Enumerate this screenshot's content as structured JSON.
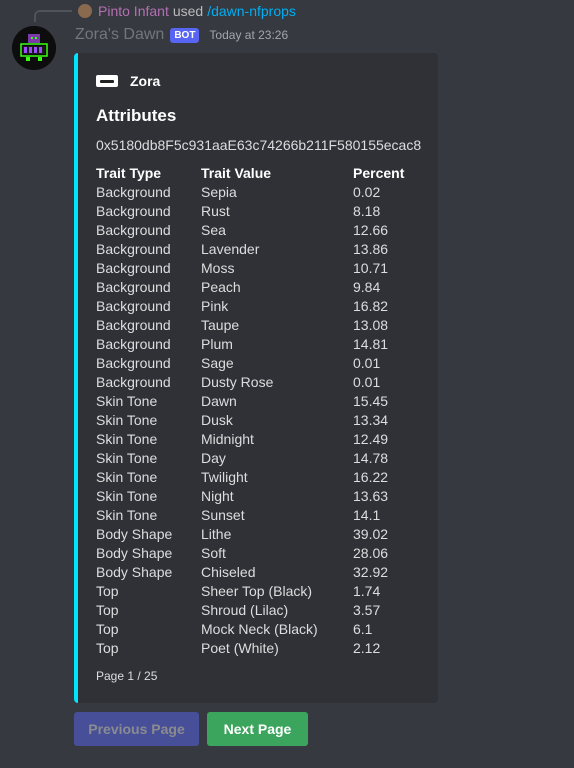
{
  "reply": {
    "user": "Pinto Infant",
    "used": "used",
    "command": "/dawn-nfprops"
  },
  "message": {
    "username": "Zora's Dawn",
    "bot_tag": "BOT",
    "timestamp": "Today at 23:26"
  },
  "embed": {
    "accent_color": "#00e5ff",
    "author": "Zora",
    "title": "Attributes",
    "address": "0x5180db8F5c931aaE63c74266b211F580155ecac8",
    "headers": {
      "type": "Trait Type",
      "value": "Trait Value",
      "percent": "Percent"
    },
    "rows": [
      {
        "type": "Background",
        "value": "Sepia",
        "percent": "0.02"
      },
      {
        "type": "Background",
        "value": "Rust",
        "percent": "8.18"
      },
      {
        "type": "Background",
        "value": "Sea",
        "percent": "12.66"
      },
      {
        "type": "Background",
        "value": "Lavender",
        "percent": "13.86"
      },
      {
        "type": "Background",
        "value": "Moss",
        "percent": "10.71"
      },
      {
        "type": "Background",
        "value": "Peach",
        "percent": "9.84"
      },
      {
        "type": "Background",
        "value": "Pink",
        "percent": "16.82"
      },
      {
        "type": "Background",
        "value": "Taupe",
        "percent": "13.08"
      },
      {
        "type": "Background",
        "value": "Plum",
        "percent": "14.81"
      },
      {
        "type": "Background",
        "value": "Sage",
        "percent": "0.01"
      },
      {
        "type": "Background",
        "value": "Dusty Rose",
        "percent": "0.01"
      },
      {
        "type": "Skin Tone",
        "value": "Dawn",
        "percent": "15.45"
      },
      {
        "type": "Skin Tone",
        "value": "Dusk",
        "percent": "13.34"
      },
      {
        "type": "Skin Tone",
        "value": "Midnight",
        "percent": "12.49"
      },
      {
        "type": "Skin Tone",
        "value": "Day",
        "percent": "14.78"
      },
      {
        "type": "Skin Tone",
        "value": "Twilight",
        "percent": "16.22"
      },
      {
        "type": "Skin Tone",
        "value": "Night",
        "percent": "13.63"
      },
      {
        "type": "Skin Tone",
        "value": "Sunset",
        "percent": "14.1"
      },
      {
        "type": "Body Shape",
        "value": "Lithe",
        "percent": "39.02"
      },
      {
        "type": "Body Shape",
        "value": "Soft",
        "percent": "28.06"
      },
      {
        "type": "Body Shape",
        "value": "Chiseled",
        "percent": "32.92"
      },
      {
        "type": "Top",
        "value": "Sheer Top (Black)",
        "percent": "1.74"
      },
      {
        "type": "Top",
        "value": "Shroud (Lilac)",
        "percent": "3.57"
      },
      {
        "type": "Top",
        "value": "Mock Neck (Black)",
        "percent": "6.1"
      },
      {
        "type": "Top",
        "value": "Poet (White)",
        "percent": "2.12"
      }
    ],
    "footer": "Page 1 / 25"
  },
  "buttons": {
    "previous": "Previous Page",
    "next": "Next Page"
  }
}
